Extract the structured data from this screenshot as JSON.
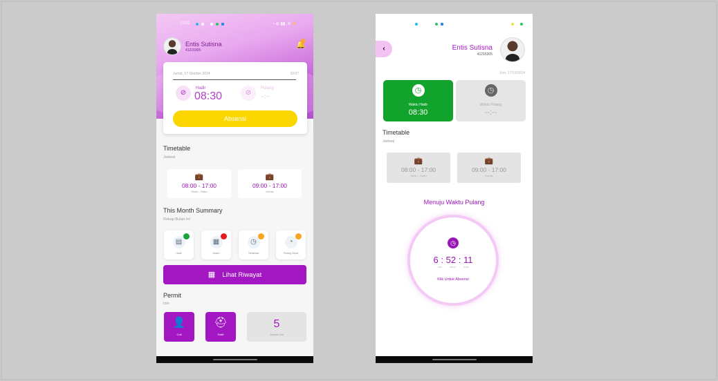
{
  "screen1": {
    "status_time": "10:01",
    "status_right": "▪ ◍ ▮▮ .ıll ⚡",
    "user": {
      "name": "Entis Sutisna",
      "id": "41215305"
    },
    "attendance": {
      "date": "Jumat, 17 Oktober 2024",
      "clock": "10:07",
      "in_label": "Hadir",
      "in_time": "08:30",
      "out_label": "Pulang",
      "out_time": "--:--",
      "button": "Absensi"
    },
    "timetable": {
      "title": "Timetable",
      "subtitle": "Jadwal",
      "items": [
        {
          "time": "08:00 - 17:00",
          "days": "Senin - Rabu"
        },
        {
          "time": "09:00 - 17:00",
          "days": "Kamis"
        }
      ]
    },
    "summary": {
      "title": "This Month Summary",
      "subtitle": "Rekap Bulan Ini",
      "items": [
        {
          "label": "Hadir",
          "badge_color": "#1aa33a"
        },
        {
          "label": "Absen",
          "badge_color": "#e11d1d"
        },
        {
          "label": "Terlambat",
          "badge_color": "#f5a623"
        },
        {
          "label": "Pulang Cepat",
          "badge_color": "#f5a623"
        }
      ]
    },
    "history_button": "Lihat Riwayat",
    "permit": {
      "title": "Permit",
      "subtitle": "Izin",
      "cuti": "Cuti",
      "sakit": "Sakit",
      "total_value": "5",
      "total_label": "Jumlah Izin"
    }
  },
  "screen2": {
    "user": {
      "name": "Entis Sutisna",
      "id": "41215305"
    },
    "date": "Jum, 17/10/2024",
    "in_card": {
      "label": "Waktu Hadir",
      "time": "08:30"
    },
    "out_card": {
      "label": "Waktu Pulang",
      "time": "--:--"
    },
    "timetable": {
      "title": "Timetable",
      "subtitle": "Jadwal",
      "items": [
        {
          "time": "08:00 - 17:00",
          "days": "Senin - Rabu"
        },
        {
          "time": "09:00 - 17:00",
          "days": "Kamis"
        }
      ]
    },
    "heading": "Menuju Waktu Pulang",
    "countdown": {
      "hours": "6",
      "minutes": "52",
      "seconds": "11",
      "units": "Jam Menit Detik"
    },
    "click_text": "Klik Untuk Absensi"
  },
  "colors": {
    "purple": "#a317c3",
    "yellow": "#fbd600",
    "green": "#11a32b"
  },
  "icons": [
    "bell-icon",
    "check-circle-icon",
    "briefcase-clock-icon",
    "clipboard-icon",
    "calendar-icon",
    "clock-alarm-icon",
    "calendar-grid-icon",
    "user-clock-icon",
    "doctor-icon",
    "back-arrow-icon",
    "clock-icon"
  ]
}
